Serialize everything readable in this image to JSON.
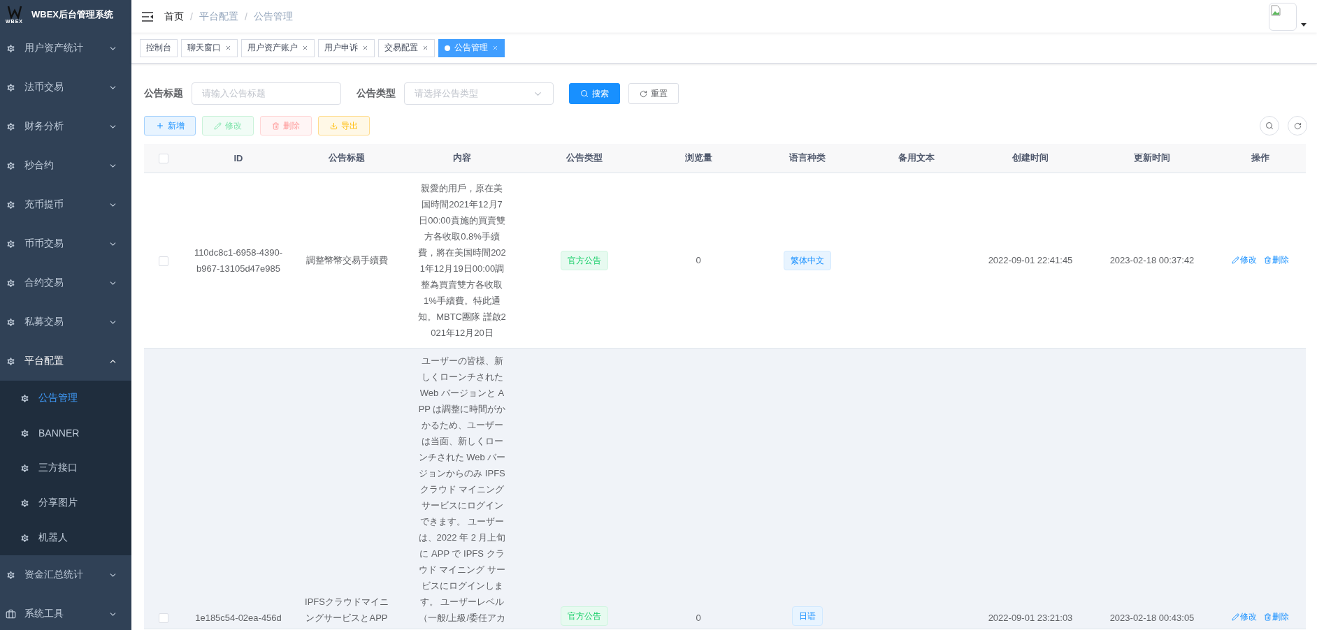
{
  "sidebar": {
    "logo_text": "WBEX",
    "title": "WBEX后台管理系统",
    "items": [
      {
        "label": "用户资产统计",
        "kind": "menu",
        "expanded": false
      },
      {
        "label": "法币交易",
        "kind": "menu",
        "expanded": false
      },
      {
        "label": "财务分析",
        "kind": "menu",
        "expanded": false
      },
      {
        "label": "秒合约",
        "kind": "menu",
        "expanded": false
      },
      {
        "label": "充币提币",
        "kind": "menu",
        "expanded": false
      },
      {
        "label": "币币交易",
        "kind": "menu",
        "expanded": false
      },
      {
        "label": "合约交易",
        "kind": "menu",
        "expanded": false
      },
      {
        "label": "私募交易",
        "kind": "menu",
        "expanded": false
      },
      {
        "label": "平台配置",
        "kind": "menu",
        "expanded": true,
        "children": [
          {
            "label": "公告管理",
            "selected": true
          },
          {
            "label": "BANNER",
            "selected": false
          },
          {
            "label": "三方接口",
            "selected": false
          },
          {
            "label": "分享图片",
            "selected": false
          },
          {
            "label": "机器人",
            "selected": false
          }
        ]
      },
      {
        "label": "资金汇总统计",
        "kind": "menu",
        "expanded": false
      },
      {
        "label": "系统工具",
        "kind": "tools",
        "expanded": false
      }
    ]
  },
  "breadcrumb": {
    "separator": "/",
    "items": [
      {
        "label": "首页",
        "kind": "link"
      },
      {
        "label": "平台配置",
        "kind": "text"
      },
      {
        "label": "公告管理",
        "kind": "text"
      }
    ]
  },
  "tags_view": [
    {
      "label": "控制台",
      "selected": false,
      "closable": false
    },
    {
      "label": "聊天窗口",
      "selected": false,
      "closable": true
    },
    {
      "label": "用户资产账户",
      "selected": false,
      "closable": true
    },
    {
      "label": "用户申诉",
      "selected": false,
      "closable": true
    },
    {
      "label": "交易配置",
      "selected": false,
      "closable": true
    },
    {
      "label": "公告管理",
      "selected": true,
      "closable": true
    }
  ],
  "filters": [
    {
      "label": "公告标题",
      "kind": "input",
      "placeholder": "请输入公告标题"
    },
    {
      "label": "公告类型",
      "kind": "select",
      "placeholder": "请选择公告类型"
    }
  ],
  "search_buttons": [
    {
      "label": "搜索",
      "kind": "primary"
    },
    {
      "label": "重置",
      "kind": "default"
    }
  ],
  "toolbar": [
    {
      "label": "新增",
      "kind": "primary",
      "disabled": false
    },
    {
      "label": "修改",
      "kind": "success",
      "disabled": true
    },
    {
      "label": "删除",
      "kind": "danger",
      "disabled": true
    },
    {
      "label": "导出",
      "kind": "warning",
      "disabled": false
    }
  ],
  "table": {
    "select_all": {
      "checked": false
    },
    "columns": [
      "ID",
      "公告标题",
      "内容",
      "公告类型",
      "浏览量",
      "语言种类",
      "备用文本",
      "创建时间",
      "更新时间",
      "操作"
    ],
    "rows": [
      {
        "checked": false,
        "hovered": false,
        "id_lines": [
          "110dc8c1-6958-4390-",
          "b967-13105d47e985"
        ],
        "title_lines": [
          "調整幣幣交易手續費"
        ],
        "content_lines": [
          "親愛的用戶，原在美",
          "国時間2021年12月7",
          "日00:00賁施的買賣雙",
          "方各收取0.8%手續",
          "費，將在美国時間202",
          "1年12月19日00:00調",
          "整為買賣雙方各收取",
          "1%手續費。特此通",
          "知。MBTC團隊 謹啟2",
          "021年12月20日"
        ],
        "type": "官方公告",
        "views": "0",
        "language": "繁体中文",
        "created": "2022-09-01 22:41:45",
        "updated": "2023-02-18 00:37:42",
        "actions": [
          {
            "label": "修改",
            "kind": "edit"
          },
          {
            "label": "删除",
            "kind": "delete"
          }
        ]
      },
      {
        "checked": false,
        "hovered": true,
        "id_lines": [
          "1e185c54-02ea-456d"
        ],
        "title_lines": [
          "IPFSクラウドマイニ",
          "ングサービスとAPP"
        ],
        "content_lines": [
          "ユーザーの皆様、新",
          "しくローンチされた",
          "Web バージョンと A",
          "PP は調整に時間がか",
          "かるため、ユーザー",
          "は当面、新しくロー",
          "ンチされた Web バー",
          "ジョンからのみ IPFS",
          "クラウド マイニング",
          "サービスにログイン",
          "できます。 ユーザー",
          "は、2022 年 2 月上旬",
          "に APP で IPFS クラ",
          "ウド マイニング サー",
          "ビスにログインしま",
          "す。 ユーザーレベル",
          "（一般/上級/委任アカ"
        ],
        "type": "官方公告",
        "views": "0",
        "language": "日语",
        "created": "2022-09-01 23:21:03",
        "updated": "2023-02-18 00:43:05",
        "actions": [
          {
            "label": "修改",
            "kind": "edit"
          },
          {
            "label": "删除",
            "kind": "delete"
          }
        ]
      }
    ]
  }
}
